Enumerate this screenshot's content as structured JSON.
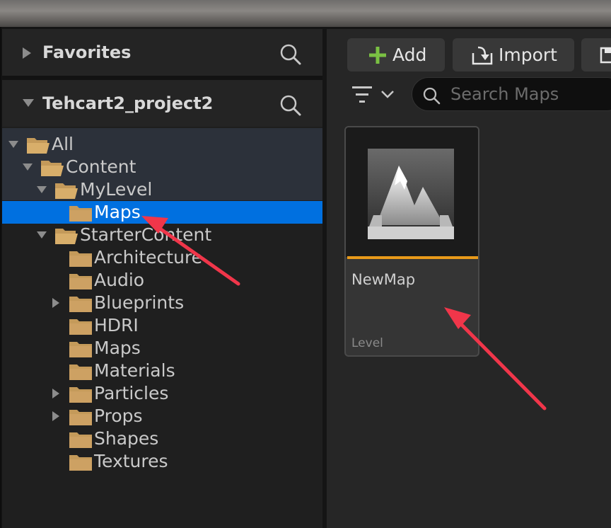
{
  "sections": {
    "favorites": "Favorites",
    "project": "Tehcart2_project2"
  },
  "tree": [
    {
      "label": "All",
      "depth": 0,
      "expanded": true,
      "has_children": true,
      "open_folder": true,
      "selected": false
    },
    {
      "label": "Content",
      "depth": 1,
      "expanded": true,
      "has_children": true,
      "open_folder": true,
      "selected": false
    },
    {
      "label": "MyLevel",
      "depth": 2,
      "expanded": true,
      "has_children": true,
      "open_folder": true,
      "selected": false
    },
    {
      "label": "Maps",
      "depth": 3,
      "expanded": false,
      "has_children": false,
      "open_folder": false,
      "selected": true
    },
    {
      "label": "StarterContent",
      "depth": 2,
      "expanded": true,
      "has_children": true,
      "open_folder": true,
      "selected": false
    },
    {
      "label": "Architecture",
      "depth": 3,
      "expanded": false,
      "has_children": false,
      "open_folder": false,
      "selected": false
    },
    {
      "label": "Audio",
      "depth": 3,
      "expanded": false,
      "has_children": false,
      "open_folder": false,
      "selected": false
    },
    {
      "label": "Blueprints",
      "depth": 3,
      "expanded": false,
      "has_children": true,
      "open_folder": false,
      "selected": false
    },
    {
      "label": "HDRI",
      "depth": 3,
      "expanded": false,
      "has_children": false,
      "open_folder": false,
      "selected": false
    },
    {
      "label": "Maps",
      "depth": 3,
      "expanded": false,
      "has_children": false,
      "open_folder": false,
      "selected": false
    },
    {
      "label": "Materials",
      "depth": 3,
      "expanded": false,
      "has_children": false,
      "open_folder": false,
      "selected": false
    },
    {
      "label": "Particles",
      "depth": 3,
      "expanded": false,
      "has_children": true,
      "open_folder": false,
      "selected": false
    },
    {
      "label": "Props",
      "depth": 3,
      "expanded": false,
      "has_children": true,
      "open_folder": false,
      "selected": false
    },
    {
      "label": "Shapes",
      "depth": 3,
      "expanded": false,
      "has_children": false,
      "open_folder": false,
      "selected": false
    },
    {
      "label": "Textures",
      "depth": 3,
      "expanded": false,
      "has_children": false,
      "open_folder": false,
      "selected": false
    }
  ],
  "toolbar": {
    "add_label": "Add",
    "import_label": "Import"
  },
  "search": {
    "placeholder": "Search Maps"
  },
  "asset": {
    "name": "NewMap",
    "type": "Level"
  },
  "icons": {
    "add": "plus-icon",
    "import": "import-icon",
    "filter": "filter-icon",
    "search": "search-icon",
    "folder": "folder-icon",
    "level": "level-thumbnail-icon"
  },
  "colors": {
    "selection": "#0070e0",
    "folder": "#c49a5a",
    "add_plus": "#7ac143",
    "asset_bar": "#e89a1a",
    "annotation_arrow": "#f0364a"
  }
}
